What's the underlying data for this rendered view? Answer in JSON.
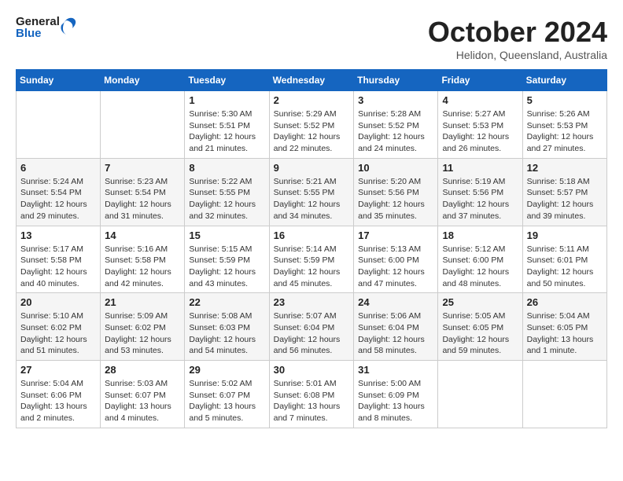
{
  "header": {
    "logo_general": "General",
    "logo_blue": "Blue",
    "title": "October 2024",
    "location": "Helidon, Queensland, Australia"
  },
  "weekdays": [
    "Sunday",
    "Monday",
    "Tuesday",
    "Wednesday",
    "Thursday",
    "Friday",
    "Saturday"
  ],
  "weeks": [
    [
      {
        "day": "",
        "info": ""
      },
      {
        "day": "",
        "info": ""
      },
      {
        "day": "1",
        "info": "Sunrise: 5:30 AM\nSunset: 5:51 PM\nDaylight: 12 hours and 21 minutes."
      },
      {
        "day": "2",
        "info": "Sunrise: 5:29 AM\nSunset: 5:52 PM\nDaylight: 12 hours and 22 minutes."
      },
      {
        "day": "3",
        "info": "Sunrise: 5:28 AM\nSunset: 5:52 PM\nDaylight: 12 hours and 24 minutes."
      },
      {
        "day": "4",
        "info": "Sunrise: 5:27 AM\nSunset: 5:53 PM\nDaylight: 12 hours and 26 minutes."
      },
      {
        "day": "5",
        "info": "Sunrise: 5:26 AM\nSunset: 5:53 PM\nDaylight: 12 hours and 27 minutes."
      }
    ],
    [
      {
        "day": "6",
        "info": "Sunrise: 5:24 AM\nSunset: 5:54 PM\nDaylight: 12 hours and 29 minutes."
      },
      {
        "day": "7",
        "info": "Sunrise: 5:23 AM\nSunset: 5:54 PM\nDaylight: 12 hours and 31 minutes."
      },
      {
        "day": "8",
        "info": "Sunrise: 5:22 AM\nSunset: 5:55 PM\nDaylight: 12 hours and 32 minutes."
      },
      {
        "day": "9",
        "info": "Sunrise: 5:21 AM\nSunset: 5:55 PM\nDaylight: 12 hours and 34 minutes."
      },
      {
        "day": "10",
        "info": "Sunrise: 5:20 AM\nSunset: 5:56 PM\nDaylight: 12 hours and 35 minutes."
      },
      {
        "day": "11",
        "info": "Sunrise: 5:19 AM\nSunset: 5:56 PM\nDaylight: 12 hours and 37 minutes."
      },
      {
        "day": "12",
        "info": "Sunrise: 5:18 AM\nSunset: 5:57 PM\nDaylight: 12 hours and 39 minutes."
      }
    ],
    [
      {
        "day": "13",
        "info": "Sunrise: 5:17 AM\nSunset: 5:58 PM\nDaylight: 12 hours and 40 minutes."
      },
      {
        "day": "14",
        "info": "Sunrise: 5:16 AM\nSunset: 5:58 PM\nDaylight: 12 hours and 42 minutes."
      },
      {
        "day": "15",
        "info": "Sunrise: 5:15 AM\nSunset: 5:59 PM\nDaylight: 12 hours and 43 minutes."
      },
      {
        "day": "16",
        "info": "Sunrise: 5:14 AM\nSunset: 5:59 PM\nDaylight: 12 hours and 45 minutes."
      },
      {
        "day": "17",
        "info": "Sunrise: 5:13 AM\nSunset: 6:00 PM\nDaylight: 12 hours and 47 minutes."
      },
      {
        "day": "18",
        "info": "Sunrise: 5:12 AM\nSunset: 6:00 PM\nDaylight: 12 hours and 48 minutes."
      },
      {
        "day": "19",
        "info": "Sunrise: 5:11 AM\nSunset: 6:01 PM\nDaylight: 12 hours and 50 minutes."
      }
    ],
    [
      {
        "day": "20",
        "info": "Sunrise: 5:10 AM\nSunset: 6:02 PM\nDaylight: 12 hours and 51 minutes."
      },
      {
        "day": "21",
        "info": "Sunrise: 5:09 AM\nSunset: 6:02 PM\nDaylight: 12 hours and 53 minutes."
      },
      {
        "day": "22",
        "info": "Sunrise: 5:08 AM\nSunset: 6:03 PM\nDaylight: 12 hours and 54 minutes."
      },
      {
        "day": "23",
        "info": "Sunrise: 5:07 AM\nSunset: 6:04 PM\nDaylight: 12 hours and 56 minutes."
      },
      {
        "day": "24",
        "info": "Sunrise: 5:06 AM\nSunset: 6:04 PM\nDaylight: 12 hours and 58 minutes."
      },
      {
        "day": "25",
        "info": "Sunrise: 5:05 AM\nSunset: 6:05 PM\nDaylight: 12 hours and 59 minutes."
      },
      {
        "day": "26",
        "info": "Sunrise: 5:04 AM\nSunset: 6:05 PM\nDaylight: 13 hours and 1 minute."
      }
    ],
    [
      {
        "day": "27",
        "info": "Sunrise: 5:04 AM\nSunset: 6:06 PM\nDaylight: 13 hours and 2 minutes."
      },
      {
        "day": "28",
        "info": "Sunrise: 5:03 AM\nSunset: 6:07 PM\nDaylight: 13 hours and 4 minutes."
      },
      {
        "day": "29",
        "info": "Sunrise: 5:02 AM\nSunset: 6:07 PM\nDaylight: 13 hours and 5 minutes."
      },
      {
        "day": "30",
        "info": "Sunrise: 5:01 AM\nSunset: 6:08 PM\nDaylight: 13 hours and 7 minutes."
      },
      {
        "day": "31",
        "info": "Sunrise: 5:00 AM\nSunset: 6:09 PM\nDaylight: 13 hours and 8 minutes."
      },
      {
        "day": "",
        "info": ""
      },
      {
        "day": "",
        "info": ""
      }
    ]
  ]
}
